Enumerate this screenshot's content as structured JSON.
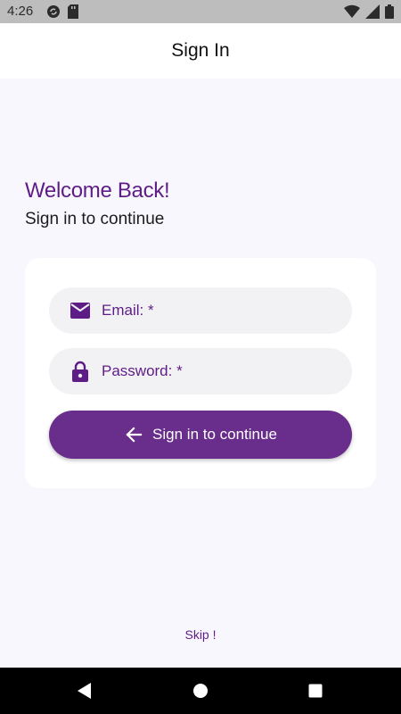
{
  "status_bar": {
    "time": "4:26",
    "left_icons": [
      "sync-icon",
      "sd-card-icon"
    ],
    "right_icons": [
      "wifi-icon",
      "signal-icon",
      "battery-icon"
    ]
  },
  "app_bar": {
    "title": "Sign In"
  },
  "welcome": {
    "heading": "Welcome Back!",
    "subtitle": "Sign in to continue"
  },
  "form": {
    "email": {
      "icon": "mail-icon",
      "label": "Email: *"
    },
    "password": {
      "icon": "lock-icon",
      "label": "Password: *"
    },
    "submit": {
      "icon": "arrow-left-icon",
      "label": "Sign in to continue"
    }
  },
  "skip": {
    "label": "Skip !"
  },
  "nav_bar": {
    "icons": [
      "back-icon",
      "home-icon",
      "recents-icon"
    ]
  },
  "colors": {
    "accent": "#5e1d86",
    "button": "#692d8c",
    "background": "#f9f7fe",
    "field": "#f2f2f5"
  }
}
